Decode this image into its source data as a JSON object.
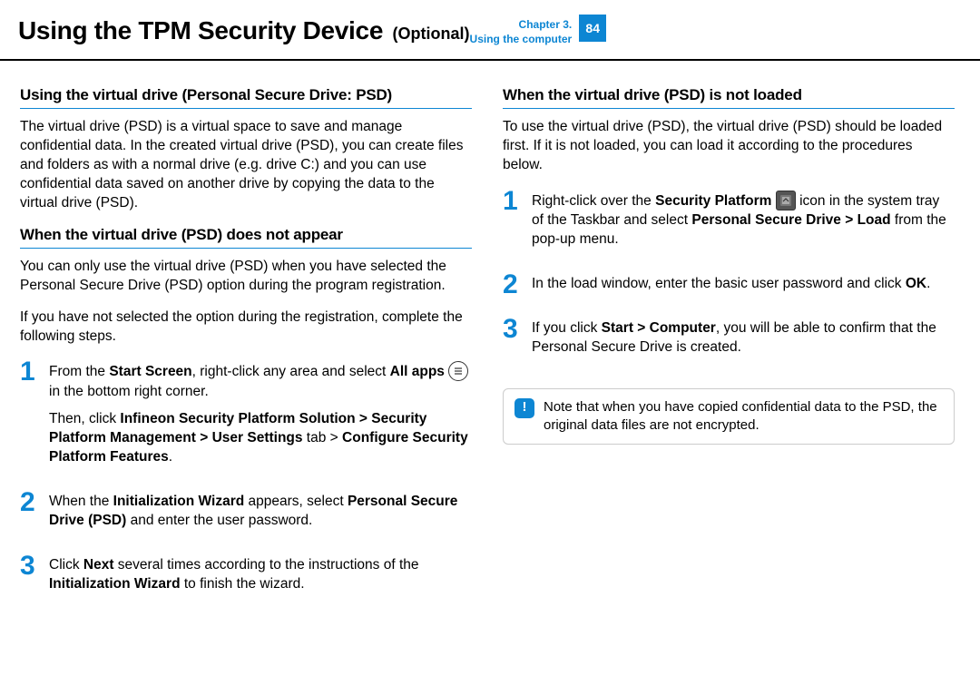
{
  "header": {
    "title": "Using the TPM Security Device",
    "subtitle": "(Optional)",
    "chapter_line1": "Chapter 3.",
    "chapter_line2": "Using the computer",
    "page": "84"
  },
  "left": {
    "section1": {
      "heading": "Using the virtual drive (Personal Secure Drive: PSD)",
      "para": "The virtual drive (PSD) is a virtual space to save and manage confidential data. In the created virtual drive (PSD), you can create files and folders as with a normal drive (e.g. drive C:) and you can use confidential data saved on another drive by copying the data to the virtual drive (PSD)."
    },
    "section2": {
      "heading": "When the virtual drive (PSD) does not appear",
      "para1": "You can only use the virtual drive (PSD) when you have selected the Personal Secure Drive (PSD) option during the program registration.",
      "para2": " If you have not selected the option during the registration, complete the following steps.",
      "steps": {
        "s1_a": "From the ",
        "s1_b": "Start Screen",
        "s1_c": ", right-click any area and select ",
        "s1_d": "All apps",
        "s1_e": " in the bottom right corner.",
        "s1_f": "Then, click ",
        "s1_g": "Infineon Security Platform Solution > Security Platform Management > User Settings",
        "s1_h": " tab > ",
        "s1_i": "Configure Security Platform Features",
        "s1_j": ".",
        "s2_a": "When the ",
        "s2_b": "Initialization Wizard",
        "s2_c": " appears, select ",
        "s2_d": "Personal Secure Drive (PSD)",
        "s2_e": " and enter the user password.",
        "s3_a": "Click ",
        "s3_b": "Next",
        "s3_c": " several times according to the instructions of the ",
        "s3_d": "Initialization Wizard",
        "s3_e": " to finish the wizard."
      }
    }
  },
  "right": {
    "section1": {
      "heading": "When the virtual drive (PSD) is not loaded",
      "para": "To use the virtual drive (PSD), the virtual drive (PSD) should be loaded first. If it is not loaded, you can load it according to the procedures below.",
      "steps": {
        "s1_a": "Right-click over the ",
        "s1_b": "Security Platform",
        "s1_c": " icon in the system tray of the Taskbar and select ",
        "s1_d": "Personal Secure Drive > Load",
        "s1_e": " from the pop-up menu.",
        "s2_a": "In the load window, enter the basic user password and click ",
        "s2_b": "OK",
        "s2_c": ".",
        "s3_a": "If you click ",
        "s3_b": "Start > Computer",
        "s3_c": ", you will be able to confirm that the Personal Secure Drive is created."
      }
    },
    "note": "Note that when you have copied confidential data to the PSD, the original data files are not encrypted."
  },
  "nums": {
    "one": "1",
    "two": "2",
    "three": "3"
  },
  "icons": {
    "allapps": "≡",
    "note": "!"
  }
}
